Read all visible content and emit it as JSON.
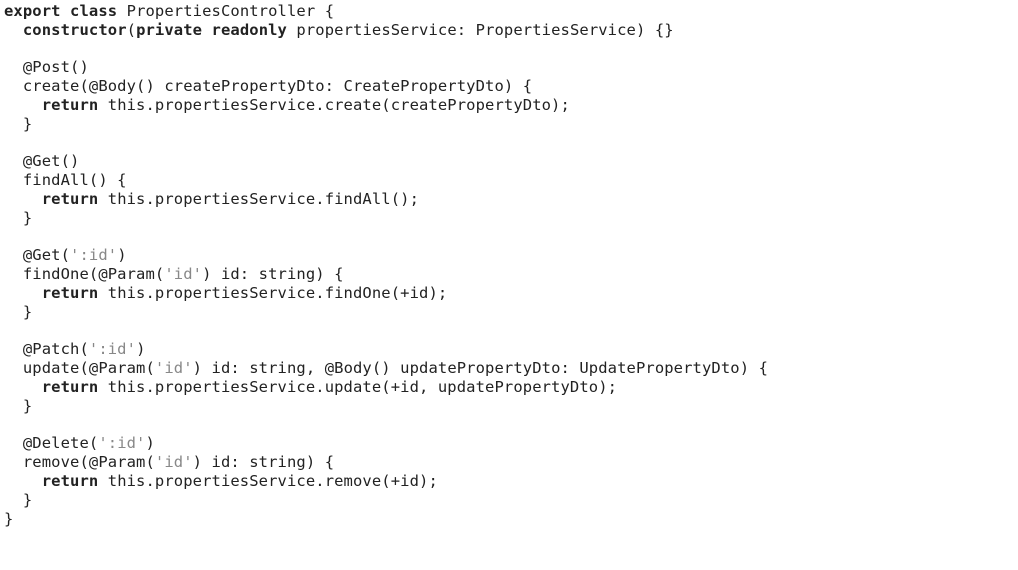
{
  "code": {
    "l01a": "export",
    "l01b": " ",
    "l01c": "class",
    "l01d": " PropertiesController {",
    "l02a": "  ",
    "l02b": "constructor",
    "l02c": "(",
    "l02d": "private",
    "l02e": " ",
    "l02f": "readonly",
    "l02g": " propertiesService: PropertiesService) {}",
    "l03": "",
    "l04": "  @Post()",
    "l05": "  create(@Body() createPropertyDto: CreatePropertyDto) {",
    "l06a": "    ",
    "l06b": "return",
    "l06c": " this.propertiesService.create(createPropertyDto);",
    "l07": "  }",
    "l08": "",
    "l09": "  @Get()",
    "l10": "  findAll() {",
    "l11a": "    ",
    "l11b": "return",
    "l11c": " this.propertiesService.findAll();",
    "l12": "  }",
    "l13": "",
    "l14a": "  @Get(",
    "l14b": "':id'",
    "l14c": ")",
    "l15a": "  findOne(@Param(",
    "l15b": "'id'",
    "l15c": ") id: string) {",
    "l16a": "    ",
    "l16b": "return",
    "l16c": " this.propertiesService.findOne(+id);",
    "l17": "  }",
    "l18": "",
    "l19a": "  @Patch(",
    "l19b": "':id'",
    "l19c": ")",
    "l20a": "  update(@Param(",
    "l20b": "'id'",
    "l20c": ") id: string, @Body() updatePropertyDto: UpdatePropertyDto) {",
    "l21a": "    ",
    "l21b": "return",
    "l21c": " this.propertiesService.update(+id, updatePropertyDto);",
    "l22": "  }",
    "l23": "",
    "l24a": "  @Delete(",
    "l24b": "':id'",
    "l24c": ")",
    "l25a": "  remove(@Param(",
    "l25b": "'id'",
    "l25c": ") id: string) {",
    "l26a": "    ",
    "l26b": "return",
    "l26c": " this.propertiesService.remove(+id);",
    "l27": "  }",
    "l28": "}"
  }
}
